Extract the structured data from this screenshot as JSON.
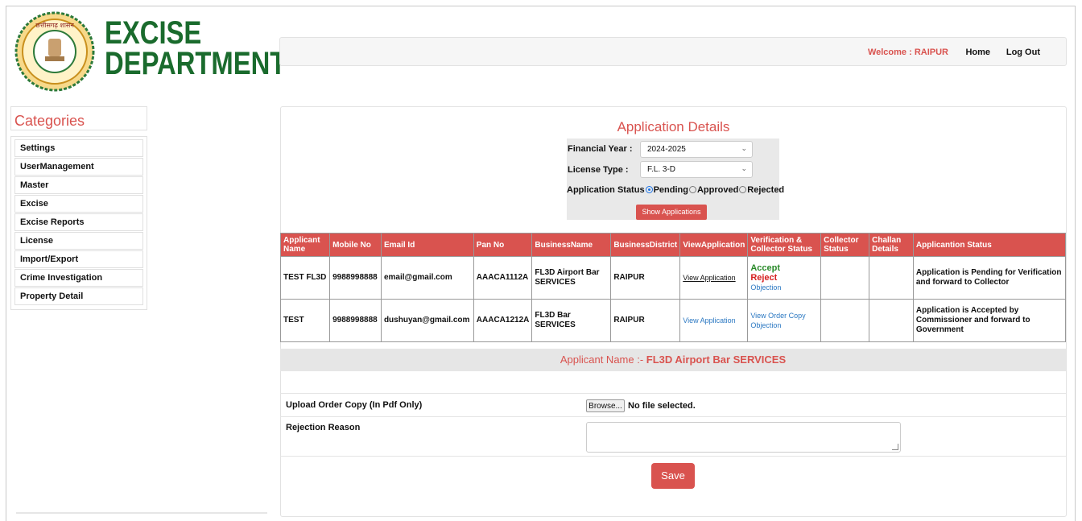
{
  "logo": {
    "line1": "EXCISE",
    "line2": "DEPARTMENT",
    "seal_text": "छत्तीसगढ़ शासन"
  },
  "header": {
    "welcome": "Welcome : RAIPUR",
    "home": "Home",
    "logout": "Log Out"
  },
  "sidebar": {
    "title": "Categories",
    "items": [
      "Settings",
      "UserManagement",
      "Master",
      "Excise",
      "Excise Reports",
      "License",
      "Import/Export",
      "Crime Investigation",
      "Property Detail"
    ]
  },
  "main": {
    "title": "Application Details",
    "filters": {
      "fy_label": "Financial Year :",
      "fy_value": "2024-2025",
      "lt_label": "License Type :",
      "lt_value": "F.L. 3-D",
      "status_label": "Application Status",
      "opt_pending": "Pending",
      "opt_approved": "Approved",
      "opt_rejected": "Rejected",
      "show_button": "Show Applications"
    },
    "table": {
      "headers": [
        "Applicant Name",
        "Mobile No",
        "Email Id",
        "Pan No",
        "BusinessName",
        "BusinessDistrict",
        "ViewApplication",
        "Verification & Collector Status",
        "Collector Status",
        "Challan Details",
        "Applicantion Status"
      ],
      "rows": [
        {
          "name": "TEST FL3D",
          "mobile": "9988998888",
          "email": "email@gmail.com",
          "pan": "AAACA1112A",
          "business": "FL3D Airport Bar SERVICES",
          "district": "RAIPUR",
          "view": "View Application",
          "accept": "Accept",
          "reject": "Reject",
          "objection": "Objection",
          "collector": "",
          "challan": "",
          "status": "Application is Pending for Verification and forward to Collector"
        },
        {
          "name": "TEST",
          "mobile": "9988998888",
          "email": "dushuyan@gmail.com",
          "pan": "AAACA1212A",
          "business": "FL3D Bar SERVICES",
          "district": "RAIPUR",
          "view": "View Application",
          "view_order": "View Order Copy",
          "objection": "Objection",
          "collector": "",
          "challan": "",
          "status": "Application is Accepted by Commissioner and forward to Government"
        }
      ]
    },
    "applicant_prefix": "Applicant Name :- ",
    "applicant_name": "FL3D Airport Bar SERVICES",
    "upload_label": "Upload Order Copy (In Pdf Only)",
    "browse_label": "Browse...",
    "no_file": "No file selected.",
    "rejection_label": "Rejection Reason",
    "save_label": "Save"
  },
  "colors": {
    "accent": "#d9534f",
    "brand_green": "#1a6b2d",
    "link_blue": "#2b78c2"
  }
}
